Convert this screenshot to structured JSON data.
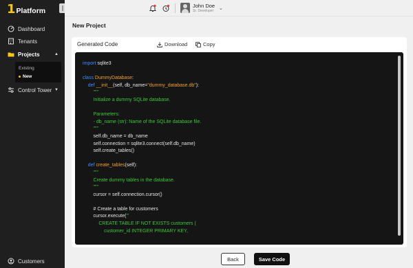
{
  "app": {
    "logo_mark": "1",
    "logo_text": "Platform"
  },
  "sidebar": {
    "items": [
      {
        "label": "Dashboard",
        "icon": "dashboard-icon"
      },
      {
        "label": "Tenants",
        "icon": "tenants-icon"
      },
      {
        "label": "Projects",
        "icon": "folder-icon",
        "active": true,
        "caret": "▲"
      },
      {
        "label": "Control Tower",
        "icon": "control-tower-icon",
        "caret": "▼"
      }
    ],
    "subitems": [
      {
        "label": "Existing"
      },
      {
        "label": "New",
        "active": true
      }
    ],
    "footer": {
      "label": "Customers",
      "icon": "customers-icon"
    }
  },
  "topbar": {
    "user_name": "John Doe",
    "user_role": "Sr. Developer",
    "caret": "⌄"
  },
  "page": {
    "title": "New Project"
  },
  "card": {
    "title": "Generated Code",
    "download_label": "Download",
    "copy_label": "Copy"
  },
  "code": [
    [
      {
        "t": "import",
        "c": "kw"
      },
      {
        "t": " sqlite3",
        "c": "plain"
      }
    ],
    [],
    [
      {
        "t": "class ",
        "c": "kw"
      },
      {
        "t": "DummyDatabase",
        "c": "fn"
      },
      {
        "t": ":",
        "c": "plain"
      }
    ],
    [
      {
        "t": "    def ",
        "c": "kw"
      },
      {
        "t": "__init__",
        "c": "fn"
      },
      {
        "t": "(self, db_name=",
        "c": "plain"
      },
      {
        "t": "\"dummy_database.db\"",
        "c": "str"
      },
      {
        "t": "):",
        "c": "plain"
      }
    ],
    [
      {
        "t": "        \"\"\"",
        "c": "doc"
      }
    ],
    [
      {
        "t": "        Initialize a dummy SQLite database.",
        "c": "doc"
      }
    ],
    [],
    [
      {
        "t": "        Parameters:",
        "c": "doc"
      }
    ],
    [
      {
        "t": "        - db_name (str): Name of the SQLite database file.",
        "c": "doc"
      }
    ],
    [
      {
        "t": "        \"\"\"",
        "c": "doc"
      }
    ],
    [
      {
        "t": "        self.db_name = db_name",
        "c": "plain"
      }
    ],
    [
      {
        "t": "        self.connection = sqlite3.connect(self.db_name)",
        "c": "plain"
      }
    ],
    [
      {
        "t": "        self.create_tables()",
        "c": "plain"
      }
    ],
    [],
    [
      {
        "t": "    def ",
        "c": "kw"
      },
      {
        "t": "create_tables",
        "c": "fn"
      },
      {
        "t": "(self):",
        "c": "plain"
      }
    ],
    [
      {
        "t": "        \"\"\"",
        "c": "doc"
      }
    ],
    [
      {
        "t": "        Create dummy tables in the database.",
        "c": "doc"
      }
    ],
    [
      {
        "t": "        \"\"\"",
        "c": "doc"
      }
    ],
    [
      {
        "t": "        cursor = self.connection.cursor()",
        "c": "plain"
      }
    ],
    [],
    [
      {
        "t": "        # Create a table for customers",
        "c": "plain"
      }
    ],
    [
      {
        "t": "        cursor.execute(",
        "c": "plain"
      },
      {
        "t": "'''",
        "c": "doc"
      }
    ],
    [
      {
        "t": "            CREATE TABLE IF NOT EXISTS customers (",
        "c": "doc"
      }
    ],
    [
      {
        "t": "                customer_id INTEGER PRIMARY KEY,",
        "c": "doc"
      }
    ]
  ],
  "footer": {
    "back_label": "Back",
    "save_label": "Save Code"
  }
}
